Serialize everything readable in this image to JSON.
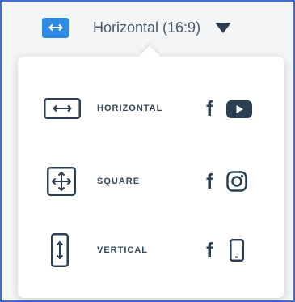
{
  "format_selector": {
    "label": "Horizontal (16:9)"
  },
  "options": [
    {
      "label": "HORIZONTAL",
      "icon": "horizontal-arrows-icon",
      "platforms": [
        "facebook-icon",
        "youtube-icon"
      ]
    },
    {
      "label": "SQUARE",
      "icon": "four-way-arrows-icon",
      "platforms": [
        "facebook-icon",
        "instagram-icon"
      ]
    },
    {
      "label": "VERTICAL",
      "icon": "vertical-arrows-icon",
      "platforms": [
        "facebook-icon",
        "phone-icon"
      ]
    }
  ],
  "platform_glyph": "f",
  "colors": {
    "accent": "#2f8ae6",
    "text": "#33475b",
    "frame_border": "#3f6bd6"
  }
}
